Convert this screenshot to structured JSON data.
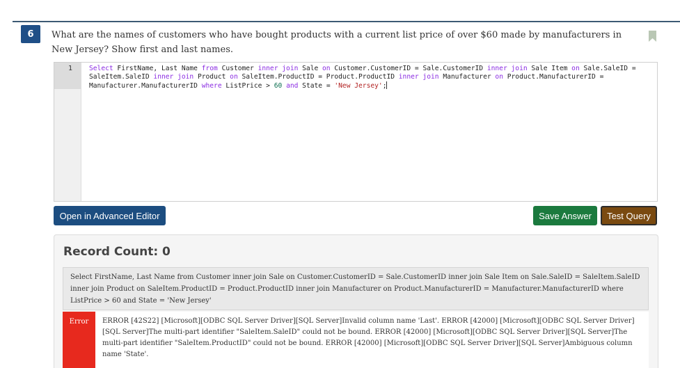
{
  "question": {
    "number": "6",
    "text": "What are the names of customers who have bought products with a current list price of over $60 made by manufacturers in New Jersey? Show first and last names."
  },
  "editor": {
    "line_number": "1",
    "tokens": [
      {
        "t": "Select",
        "c": "kw"
      },
      {
        "t": " FirstName, Last Name ",
        "c": ""
      },
      {
        "t": "from",
        "c": "kw"
      },
      {
        "t": " Customer ",
        "c": ""
      },
      {
        "t": "inner join",
        "c": "kw"
      },
      {
        "t": " Sale ",
        "c": ""
      },
      {
        "t": "on",
        "c": "kw"
      },
      {
        "t": " Customer.CustomerID = Sale.CustomerID ",
        "c": ""
      },
      {
        "t": "inner join",
        "c": "kw"
      },
      {
        "t": " Sale Item ",
        "c": ""
      },
      {
        "t": "on",
        "c": "kw"
      },
      {
        "t": " Sale.SaleID = SaleItem.SaleID ",
        "c": ""
      },
      {
        "t": "inner join",
        "c": "kw"
      },
      {
        "t": " Product ",
        "c": ""
      },
      {
        "t": "on",
        "c": "kw"
      },
      {
        "t": " SaleItem.ProductID = Product.ProductID ",
        "c": ""
      },
      {
        "t": "inner join",
        "c": "kw"
      },
      {
        "t": " Manufacturer ",
        "c": ""
      },
      {
        "t": "on",
        "c": "kw"
      },
      {
        "t": " Product.ManufacturerID = Manufacturer.ManufacturerID ",
        "c": ""
      },
      {
        "t": "where",
        "c": "kw"
      },
      {
        "t": " ListPrice > ",
        "c": ""
      },
      {
        "t": "60",
        "c": "num"
      },
      {
        "t": " ",
        "c": ""
      },
      {
        "t": "and",
        "c": "kw"
      },
      {
        "t": " State = ",
        "c": ""
      },
      {
        "t": "'New Jersey'",
        "c": "str"
      },
      {
        "t": ";",
        "c": ""
      }
    ]
  },
  "buttons": {
    "advanced_editor": "Open in Advanced Editor",
    "save_answer": "Save Answer",
    "test_query": "Test Query"
  },
  "result": {
    "record_count": "Record Count: 0",
    "query_echo": "Select FirstName, Last Name from Customer inner join Sale on Customer.CustomerID = Sale.CustomerID inner join Sale Item on Sale.SaleID = SaleItem.SaleID inner join Product on SaleItem.ProductID = Product.ProductID inner join Manufacturer on Product.ManufacturerID = Manufacturer.ManufacturerID where ListPrice > 60 and State = 'New Jersey'",
    "error_label": "Error",
    "error_message": "ERROR [42S22] [Microsoft][ODBC SQL Server Driver][SQL Server]Invalid column name 'Last'. ERROR [42000] [Microsoft][ODBC SQL Server Driver][SQL Server]The multi-part identifier \"SaleItem.SaleID\" could not be bound. ERROR [42000] [Microsoft][ODBC SQL Server Driver][SQL Server]The multi-part identifier \"SaleItem.ProductID\" could not be bound. ERROR [42000] [Microsoft][ODBC SQL Server Driver][SQL Server]Ambiguous column name 'State'."
  },
  "colors": {
    "question_badge": "#1f4f87",
    "advanced_button": "#1c4d80",
    "save_button": "#1b7a3e",
    "test_button": "#7a4a10",
    "error_badge": "#e7291e"
  },
  "icons": {
    "bookmark": "bookmark-icon"
  }
}
